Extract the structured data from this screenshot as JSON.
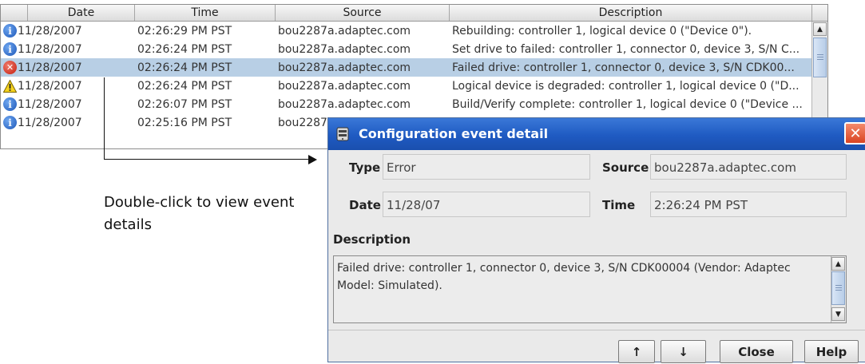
{
  "table": {
    "headers": {
      "date": "Date",
      "time": "Time",
      "source": "Source",
      "description": "Description"
    },
    "rows": [
      {
        "icon": "info-icon",
        "date": "11/28/2007",
        "time": "02:26:29 PM PST",
        "source": "bou2287a.adaptec.com",
        "description": "Rebuilding: controller 1, logical device 0 (\"Device 0\")."
      },
      {
        "icon": "info-icon",
        "date": "11/28/2007",
        "time": "02:26:24 PM PST",
        "source": "bou2287a.adaptec.com",
        "description": "Set drive to failed: controller 1, connector 0, device 3, S/N C..."
      },
      {
        "icon": "error-icon",
        "date": "11/28/2007",
        "time": "02:26:24 PM PST",
        "source": "bou2287a.adaptec.com",
        "description": "Failed drive: controller 1, connector 0, device 3, S/N CDK00...",
        "selected": true
      },
      {
        "icon": "warning-icon",
        "date": "11/28/2007",
        "time": "02:26:24 PM PST",
        "source": "bou2287a.adaptec.com",
        "description": "Logical device is degraded: controller 1, logical device 0 (\"D..."
      },
      {
        "icon": "info-icon",
        "date": "11/28/2007",
        "time": "02:26:07 PM PST",
        "source": "bou2287a.adaptec.com",
        "description": "Build/Verify complete: controller 1, logical device 0 (\"Device ..."
      },
      {
        "icon": "info-icon",
        "date": "11/28/2007",
        "time": "02:25:16 PM PST",
        "source": "bou2287",
        "description": ""
      }
    ]
  },
  "annotation": {
    "text": "Double-click to view event details"
  },
  "dialog": {
    "title": "Configuration event detail",
    "type_label": "Type",
    "type_value": "Error",
    "source_label": "Source",
    "source_value": "bou2287a.adaptec.com",
    "date_label": "Date",
    "date_value": "11/28/07",
    "time_label": "Time",
    "time_value": "2:26:24 PM PST",
    "description_label": "Description",
    "description_value": "Failed drive: controller 1, connector 0, device 3, S/N CDK00004 (Vendor: Adaptec Model: Simulated).",
    "buttons": {
      "prev": "↑",
      "next": "↓",
      "close": "Close",
      "help": "Help"
    }
  },
  "colors": {
    "selection": "#b8cfe5",
    "titlebar": "#1f5ac2",
    "close_button": "#d94422"
  }
}
